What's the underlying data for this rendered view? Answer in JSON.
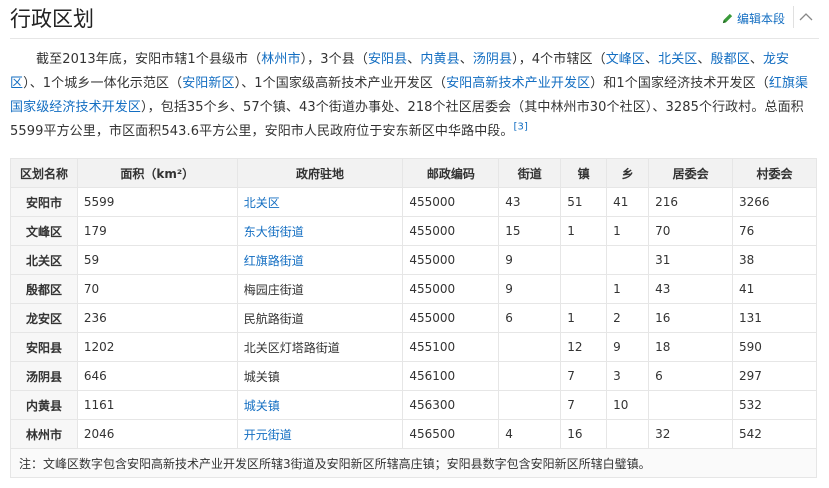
{
  "header": {
    "title": "行政区划",
    "edit_label": "编辑本段"
  },
  "para": {
    "t1": "截至2013年底，安阳市辖1个县级市（",
    "l1": "林州市",
    "t2": "），3个县（",
    "l2": "安阳县",
    "t3": "、",
    "l3": "内黄县",
    "t4": "、",
    "l4": "汤阴县",
    "t5": "），4个市辖区（",
    "l5": "文峰区",
    "t6": "、",
    "l6": "北关区",
    "t7": "、",
    "l7": "殷都区",
    "t8": "、",
    "l8": "龙安区",
    "t9": "）、1个城乡一体化示范区（",
    "l9": "安阳新区",
    "t10": "）、1个国家级高新技术产业开发区（",
    "l10": "安阳高新技术产业开发区",
    "t11": "）和1个国家经济技术开发区（",
    "l11": "红旗渠国家级经济技术开发区",
    "t12": "），包括35个乡、57个镇、43个街道办事处、218个社区居委会（其中林州市30个社区）、3285个行政村。总面积5599平方公里，市区面积543.6平方公里，安阳市人民政府位于安东新区中华路中段。",
    "ref": "[3]"
  },
  "table": {
    "headers": [
      "区划名称",
      "面积（km²）",
      "政府驻地",
      "邮政编码",
      "街道",
      "镇",
      "乡",
      "居委会",
      "村委会"
    ],
    "rows": [
      [
        "安阳市",
        "5599",
        "北关区",
        "455000",
        "43",
        "51",
        "41",
        "216",
        "3266"
      ],
      [
        "文峰区",
        "179",
        "东大街街道",
        "455000",
        "15",
        "1",
        "1",
        "70",
        "76"
      ],
      [
        "北关区",
        "59",
        "红旗路街道",
        "455000",
        "9",
        "",
        "",
        "31",
        "38"
      ],
      [
        "殷都区",
        "70",
        "梅园庄街道",
        "455000",
        "9",
        "",
        "1",
        "43",
        "41"
      ],
      [
        "龙安区",
        "236",
        "民航路街道",
        "455000",
        "6",
        "1",
        "2",
        "16",
        "131"
      ],
      [
        "安阳县",
        "1202",
        "北关区灯塔路街道",
        "455100",
        "",
        "12",
        "9",
        "18",
        "590"
      ],
      [
        "汤阴县",
        "646",
        "城关镇",
        "456100",
        "",
        "7",
        "3",
        "6",
        "297"
      ],
      [
        "内黄县",
        "1161",
        "城关镇",
        "456300",
        "",
        "7",
        "10",
        "",
        "532"
      ],
      [
        "林州市",
        "2046",
        "开元街道",
        "456500",
        "4",
        "16",
        "",
        "32",
        "542"
      ]
    ],
    "seat_links": [
      true,
      true,
      true,
      false,
      false,
      false,
      false,
      true,
      true
    ],
    "note": "注：文峰区数字包含安阳高新技术产业开发区所辖3街道及安阳新区所辖高庄镇；安阳县数字包含安阳新区所辖白璧镇。"
  },
  "colors": {
    "link": "#136ec2",
    "header_bg": "#f2f2f2",
    "border": "#e6e6e6"
  },
  "icons": {
    "edit": "pencil-icon",
    "collapse": "chevron-up-icon"
  }
}
